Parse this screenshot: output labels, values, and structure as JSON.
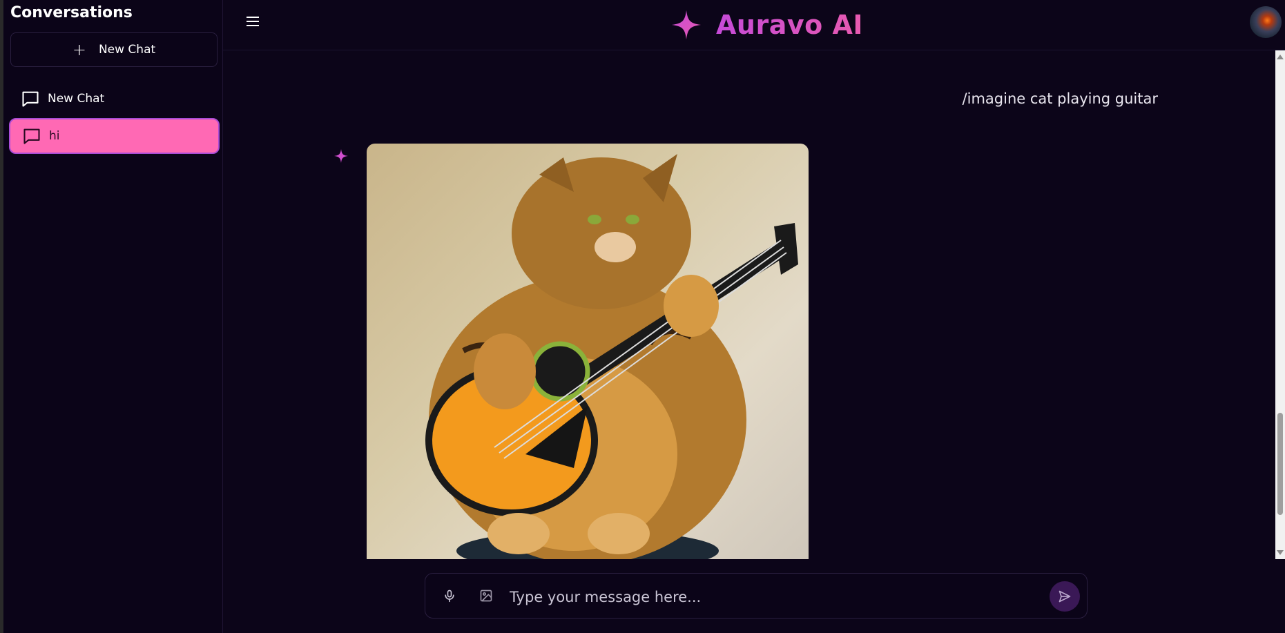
{
  "sidebar": {
    "title": "Conversations",
    "new_chat_label": "New Chat",
    "items": [
      {
        "label": "New Chat",
        "active": false
      },
      {
        "label": "hi",
        "active": true
      }
    ]
  },
  "header": {
    "brand_name": "Auravo AI"
  },
  "chat": {
    "user_message": "/imagine cat playing guitar",
    "ai_image_subject": "cat playing guitar"
  },
  "composer": {
    "placeholder": "Type your message here..."
  },
  "colors": {
    "accent": "#ff69b4",
    "brand_gradient_start": "#c64bd8",
    "brand_gradient_end": "#e85ab0",
    "background": "#0c0519"
  },
  "icons": {
    "menu": "hamburger-icon",
    "brand": "sparkle-icon",
    "chat_item": "chat-bubble-icon",
    "mic": "microphone-icon",
    "image": "image-icon",
    "send": "send-icon"
  }
}
